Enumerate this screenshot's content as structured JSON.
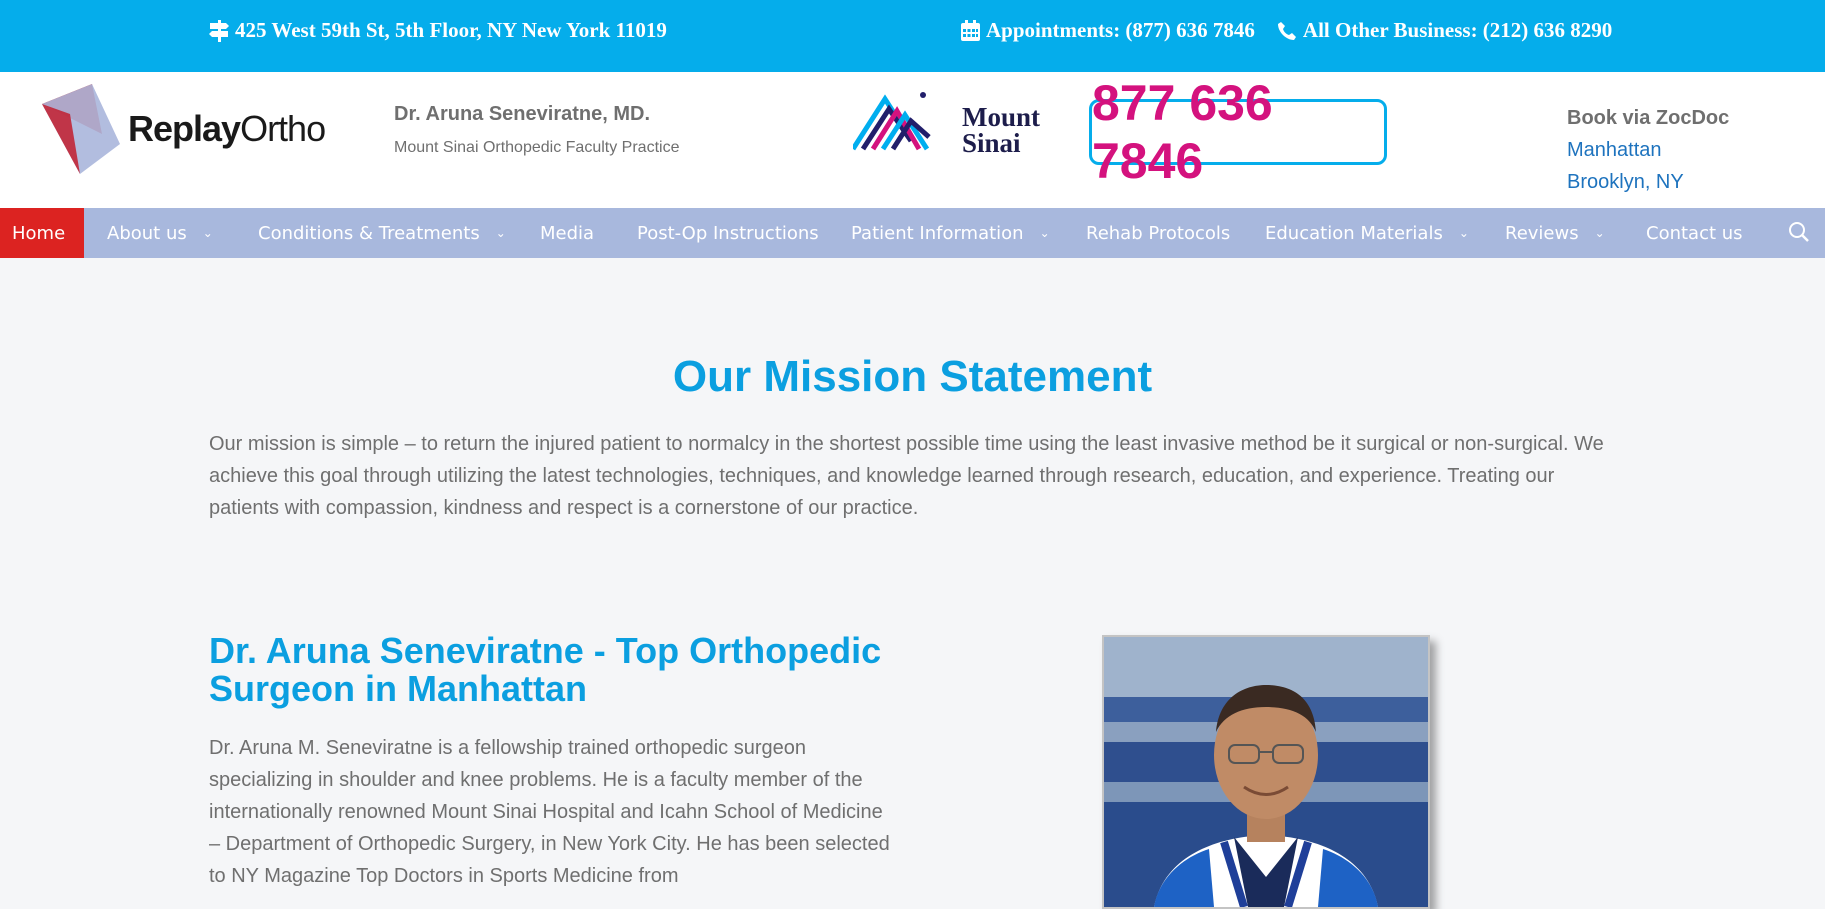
{
  "topbar": {
    "address": "425 West 59th St, 5th Floor, NY New York 11019",
    "appointments": "Appointments: (877) 636 7846",
    "business": "All Other Business: (212) 636 8290"
  },
  "header": {
    "logo_text_bold": "Replay",
    "logo_text_regular": "Ortho",
    "doctor_name": "Dr. Aruna Seneviratne, MD.",
    "practice": "Mount Sinai Orthopedic Faculty Practice",
    "partner_line1": "Mount",
    "partner_line2": "Sinai",
    "phone": "877 636 7846",
    "zocdoc_title": "Book via ZocDoc",
    "zocdoc_links": [
      "Manhattan",
      "Brooklyn, NY"
    ]
  },
  "nav": {
    "items": [
      "Home",
      "About us",
      "Conditions & Treatments",
      "Media",
      "Post-Op Instructions",
      "Patient Information",
      "Rehab Protocols",
      "Education Materials",
      "Reviews",
      "Contact us"
    ]
  },
  "mission": {
    "title": "Our Mission Statement",
    "text": "Our mission is simple – to return the injured patient to normalcy in the shortest possible time using the least invasive method be it surgical or non-surgical. We achieve this goal through utilizing the latest technologies, techniques, and knowledge learned through research, education, and experience. Treating our patients with compassion, kindness and respect is a cornerstone of our practice."
  },
  "doctor": {
    "title": "Dr. Aruna Seneviratne - Top Orthopedic Surgeon in Manhattan",
    "bio": "Dr. Aruna M. Seneviratne is a fellowship trained orthopedic surgeon specializing in shoulder and knee problems. He is a faculty member of the internationally renowned Mount Sinai Hospital and Icahn School of Medicine – Department of Orthopedic Surgery, in New York City. He has been selected to NY Magazine Top Doctors in Sports Medicine from"
  },
  "colors": {
    "topbar": "#05adeb",
    "nav": "#a8b8dd",
    "nav_active": "#dc2321",
    "heading": "#0b9fe0",
    "phone": "#d4127e",
    "link": "#1e73be"
  },
  "icons": [
    "signpost-icon",
    "calendar-icon",
    "phone-icon",
    "chevron-down-icon",
    "search-icon"
  ]
}
